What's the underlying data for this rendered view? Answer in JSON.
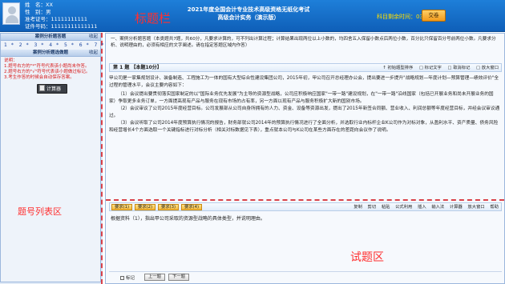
{
  "header": {
    "info": [
      {
        "label": "姓　名：",
        "value": "XX"
      },
      {
        "label": "性　别：",
        "value": "男"
      },
      {
        "label": "准考证号：",
        "value": "11111111111"
      },
      {
        "label": "证件号码：",
        "value": "11111111111111"
      }
    ],
    "area_label": "标题栏",
    "exam_title_line1": "2021年度全国会计专业技术高级资格无纸化考试",
    "exam_title_line2": "高级会计实务（演示版）",
    "timer_label": "科目剩余时间：",
    "timer_value": "03:29:07",
    "submit_label": "交卷"
  },
  "left": {
    "section1_title": "案例分析题答题",
    "section1_ctl": "收起",
    "numbers": [
      "1",
      "2",
      "3",
      "4",
      "5",
      "6",
      "7",
      "8"
    ],
    "section2_title": "案例分析题选做题",
    "section2_ctl": "收起",
    "notes_title": "说明：",
    "notes": [
      "1.题号右方的\"*\"符号代表该小题尚未作答。",
      "2.题号右方的\"√\"符号代表该小题做过标记。",
      "3.考生作答的时候会自动保存答案。"
    ],
    "calc_label": "计算器",
    "area_label": "题号列表区"
  },
  "right": {
    "description": "一、案例分析题答题（本类题共7题，共60分，凡要求计算的，可不列出计算过程；计算结果出现两位以上小数的，均四舍五入保留小数点后两位小数，百分比只保留百分号前两位小数。凡要求分析、说明理由的，必须有相应的文字阐述。请在指定答题区域内作答）",
    "question_title": "第 1 题 【本题10分】",
    "question_tools": [
      "↑ 初始题型排序",
      "□ 标记文字",
      "□ 取消标记",
      "□ 放大窗口"
    ],
    "paragraphs": [
      "甲公司是一家集规划设计、装备制造、工程施工为一体的国有大型综合性建设集团公司，2015年初，甲公司召开总经理办公会，提出要进一步提升\"战略规划—年度计划—预算管理—绩效评价\"全过程的管理水平，会议主要内容如下：",
      "（1）会议提出要贯彻落实国家制定的以\"国际业务优先发展\"为主导的资源型战略，公司应积极响应国家\"一带一路\"建设规划，在\"一带一路\"沿线国家（包括已开展业务和尚未开展业务的国家）争取更多业务订单，一方面提高现有产品与服务在现有市场的占有率，另一方面以现有产品与服务积极扩大新的国别市场。",
      "（2）会议审议了公司2015年度经营目标。公司发展部从公司自身所拥有的人力、资金、设备等资源出发，提出了2015年新签合同额、营业收入、利润总额等年度经营目标，并经会议审议通过。",
      "（3）会议听取了公司2014年度预算执行情况的报告，财务部就公司2014年的预算执行情况进行了全面分析，并选取行业内标杆企业K公司作为对标对象，从盈利水平、资产质量、债务风险和经营增长4个方面选取一个关键指标进行对标分析（相关对标数据见下表），重点就本公司与K公司在某些方面存在的差距向会议作了说明。"
    ],
    "answer_tabs": [
      "要求(1)",
      "要求(2)",
      "要求(3)",
      "要求(4)"
    ],
    "answer_tools": [
      "复制",
      "剪切",
      "粘贴",
      "公式利用",
      "插入",
      "输入法",
      "计算器",
      "放大窗口",
      "帮助"
    ],
    "question_prompt": "根据资料（1），指出甲公司采取的资源型战略的具体类型，并说明理由。",
    "area_label": "试题区",
    "mark_label": "标记",
    "prev_label": "上一题",
    "next_label": "下一题"
  }
}
